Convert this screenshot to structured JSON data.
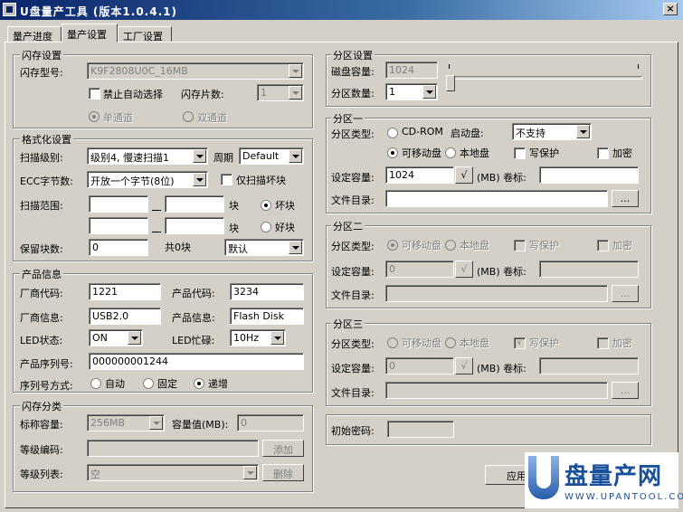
{
  "window": {
    "title": "U盘量产工具 (版本1.0.4.1)",
    "close": "×"
  },
  "tabs": [
    {
      "label": "量产进度",
      "active": false
    },
    {
      "label": "量产设置",
      "active": true
    },
    {
      "label": "工厂设置",
      "active": false
    }
  ],
  "flash_settings": {
    "title": "闪存设置",
    "model_label": "闪存型号:",
    "model_value": "K9F2808U0C_16MB",
    "disable_auto_select": "禁止自动选择",
    "chip_count_label": "闪存片数:",
    "chip_count_value": "1",
    "single_channel": "单通道",
    "dual_channel": "双通道"
  },
  "format_settings": {
    "title": "格式化设置",
    "scan_level_label": "扫描级别:",
    "scan_level_value": "级别4, 慢速扫描1",
    "cycle_label": "周期",
    "cycle_value": "Default",
    "ecc_label": "ECC字节数:",
    "ecc_value": "开放一个字节(8位)",
    "scan_bad_only": "仅扫描坏块",
    "scan_range_label": "扫描范围:",
    "block_unit": "块",
    "bad_block": "坏块",
    "good_block": "好块",
    "reserved_label": "保留块数:",
    "reserved_value": "0",
    "total_blocks": "共0块",
    "reserved_mode": "默认"
  },
  "product_info": {
    "title": "产品信息",
    "vendor_code_label": "厂商代码:",
    "vendor_code": "1221",
    "product_code_label": "产品代码:",
    "product_code": "3234",
    "vendor_info_label": "厂商信息:",
    "vendor_info": "USB2.0",
    "product_info_label": "产品信息:",
    "product_info": "Flash Disk",
    "led_status_label": "LED状态:",
    "led_status": "ON",
    "led_busy_label": "LED忙碌:",
    "led_busy": "10Hz",
    "serial_label": "产品序列号:",
    "serial": "000000001244",
    "serial_mode_label": "序列号方式:",
    "auto": "自动",
    "fixed": "固定",
    "increment": "递增"
  },
  "flash_class": {
    "title": "闪存分类",
    "nominal_label": "标称容量:",
    "nominal_value": "256MB",
    "capacity_label": "容量值(MB):",
    "capacity_value": "0",
    "grade_code_label": "等级编码:",
    "add": "添加",
    "grade_list_label": "等级列表:",
    "grade_list_value": "空",
    "delete": "删除"
  },
  "partition_settings": {
    "title": "分区设置",
    "disk_capacity_label": "磁盘容量:",
    "disk_capacity": "1024",
    "partition_count_label": "分区数量:",
    "partition_count": "1"
  },
  "partition1": {
    "title": "分区一",
    "type_label": "分区类型:",
    "cdrom": "CD-ROM",
    "boot_label": "启动盘:",
    "boot_value": "不支持",
    "removable": "可移动盘",
    "local": "本地盘",
    "write_protect": "写保护",
    "encrypt": "加密",
    "capacity_label": "设定容量:",
    "capacity": "1024",
    "check": "√",
    "unit_label": "(MB) 卷标:",
    "dir_label": "文件目录:",
    "browse": "..."
  },
  "partition2": {
    "title": "分区二",
    "type_label": "分区类型:",
    "removable": "可移动盘",
    "local": "本地盘",
    "write_protect": "写保护",
    "encrypt": "加密",
    "capacity_label": "设定容量:",
    "capacity": "0",
    "check": "√",
    "unit_label": "(MB) 卷标:",
    "dir_label": "文件目录:",
    "browse": "..."
  },
  "partition3": {
    "title": "分区三",
    "type_label": "分区类型:",
    "removable": "可移动盘",
    "local": "本地盘",
    "write_protect": "写保护",
    "write_protect_mark": "√",
    "encrypt": "加密",
    "capacity_label": "设定容量:",
    "capacity": "0",
    "check": "√",
    "unit_label": "(MB) 卷标:",
    "dir_label": "文件目录:",
    "browse": "..."
  },
  "initial_password_label": "初始密码:",
  "apply": "应用",
  "watermark": {
    "big": "盘量产网",
    "small": "WWW.UPANTOOL.COM"
  }
}
